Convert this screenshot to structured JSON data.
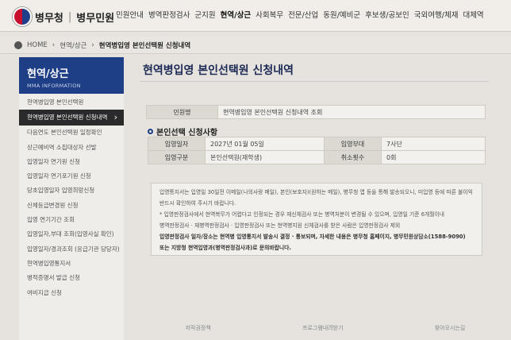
{
  "header": {
    "logo_name": "병무청",
    "logo_sep": "|",
    "logo_service": "병무민원",
    "nav": [
      "민원안내",
      "병역판정검사",
      "군지원",
      "현역/상근",
      "사회복무",
      "전문/산업",
      "동원/예비군",
      "후보생/공보인",
      "국외여행/체재",
      "대체역"
    ]
  },
  "breadcrumb": {
    "home": "HOME",
    "level1": "현역/상근",
    "current": "현역병입영 본인선택원 신청내역"
  },
  "sidebar": {
    "title": "현역/상근",
    "subtitle": "MMA INFORMATION",
    "items": [
      "현역병입영 본인선택원",
      "현역병입영 본인선택원 신청내역",
      "다음연도 본인선택원 일정확인",
      "상근예비역 소집대상자 선발",
      "입영일자 연기원 신청",
      "입영일자 연기포기원 신청",
      "당초입영일자 입영희망신청",
      "신체등급변경원 신청",
      "입영 연기기간 조회",
      "입영일자,부대 조회(입영사실 확인)",
      "입영일자/경과조회 (응급기관 당당자)",
      "현역병입영통지서",
      "병적증명서 발급 신청",
      "여비지급 신청"
    ]
  },
  "main": {
    "title": "현역병입영 본인선택원 신청내역",
    "applicant_label": "민원명",
    "applicant_value": "현역병입영 본인선택원 신청내역 조회",
    "section_title": "본인선택 신청사항",
    "enlist_date_label": "입영일자",
    "enlist_date_value": "2027년 01월 05일",
    "enlist_unit_label": "입영부대",
    "enlist_unit_value": "7사단",
    "enlist_type_label": "입영구분",
    "enlist_type_value": "본인선택원(재학생)",
    "cancel_count_label": "취소횟수",
    "cancel_count_value": "0회"
  },
  "notice": {
    "line1": "입영통지서는 입영일 30일전 이메일(나의사랑 메일), 본인(보호자)(원하는 메일), 병무청 앱 등을 통해 발송되오니, 미입영 등에 따른 불이익 방지를 위해",
    "line2": "반드시 확인하여 주시기 바랍니다.",
    "line3": "* 입영판정검사에서 현역복무가 어렵다고 인정되는 경우 재신체검사 또는 병역처분이 변경될 수 있으며, 입영일 기준 6개월이내",
    "line4": "병역판정검사 · 재병역판정검사 · 입영판정검사 또는 현역병지원 신체검사를 받은 사람은 입영판정검사 제외",
    "line5": "입영판정검사 일자/장소는 현역병 입영통지서 발송시 결정 · 통보되며, 자세한 내용은 병무청 홈페이지, 병무민원상담소(1588-9090)",
    "line6": "또는 지방청 현역입영과(병역판정검사과)로 문의바랍니다."
  },
  "footer": {
    "items": [
      "저작권정책",
      "프로그램내려받기",
      "찾아오시는길"
    ]
  }
}
